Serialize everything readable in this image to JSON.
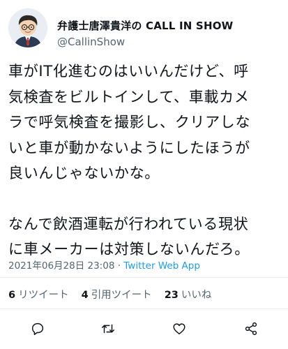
{
  "user": {
    "display_name": "弁護士唐澤貴洋の CALL IN SHOW",
    "handle": "@CallinShow"
  },
  "tweet": {
    "lines_p1": [
      "車がIT化進むのはいいんだけど、呼",
      "気検査をビルトインして、車載カメ",
      "ラで呼気検査を撮影し、クリアしな",
      "いと車が動かないようにしたほうが",
      "良いんじゃないかな。"
    ],
    "lines_p2": [
      "なんで飲酒運転が行われている現状",
      "に車メーカーは対策しないんだろ。"
    ]
  },
  "meta": {
    "timestamp": "2021年06月28日 23:08",
    "separator": " · ",
    "source": "Twitter Web App"
  },
  "stats": {
    "retweets": {
      "count": "6",
      "label": "リツイート"
    },
    "quotes": {
      "count": "4",
      "label": "引用ツイート"
    },
    "likes": {
      "count": "23",
      "label": "いいね"
    }
  },
  "actions": {
    "reply": "reply-icon",
    "retweet": "retweet-icon",
    "like": "heart-icon",
    "share": "share-icon"
  },
  "colors": {
    "text": "#0f1419",
    "secondary": "#536471",
    "link": "#1d9bf0",
    "divider": "#e6ecf0"
  }
}
